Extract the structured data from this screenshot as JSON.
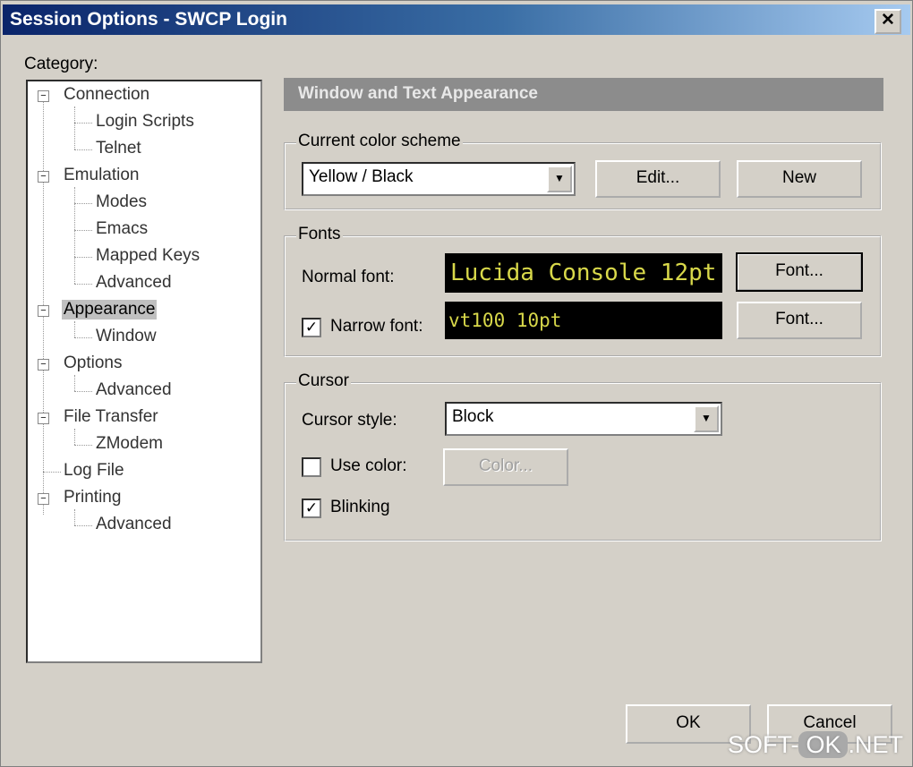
{
  "window": {
    "title": "Session Options - SWCP Login",
    "close_glyph": "✕"
  },
  "category_label": "Category:",
  "tree": {
    "connection": "Connection",
    "login_scripts": "Login Scripts",
    "telnet": "Telnet",
    "emulation": "Emulation",
    "modes": "Modes",
    "emacs": "Emacs",
    "mapped_keys": "Mapped Keys",
    "emulation_advanced": "Advanced",
    "appearance": "Appearance",
    "window": "Window",
    "options": "Options",
    "options_advanced": "Advanced",
    "file_transfer": "File Transfer",
    "zmodem": "ZModem",
    "log_file": "Log File",
    "printing": "Printing",
    "printing_advanced": "Advanced",
    "expander_glyph": "−"
  },
  "panel": {
    "header": "Window and Text Appearance",
    "color_scheme": {
      "title": "Current color scheme",
      "value": "Yellow / Black",
      "edit_label": "Edit...",
      "new_label": "New"
    },
    "fonts": {
      "title": "Fonts",
      "normal_label": "Normal font:",
      "normal_value": "Lucida Console 12pt",
      "normal_button": "Font...",
      "narrow_label": "Narrow font:",
      "narrow_value": "vt100 10pt",
      "narrow_button": "Font...",
      "narrow_checked": true
    },
    "cursor": {
      "title": "Cursor",
      "style_label": "Cursor style:",
      "style_value": "Block",
      "use_color_label": "Use color:",
      "use_color_checked": false,
      "color_button": "Color...",
      "blinking_label": "Blinking",
      "blinking_checked": true
    }
  },
  "footer": {
    "ok_label": "OK",
    "cancel_label": "Cancel"
  },
  "glyphs": {
    "dropdown": "▼",
    "check": "✓"
  },
  "watermark": {
    "left": "SOFT-",
    "ok": "OK",
    "right": ".NET"
  },
  "colors": {
    "title_start": "#0a246a",
    "font_fg": "#d8d84a",
    "font_bg": "#000000"
  }
}
